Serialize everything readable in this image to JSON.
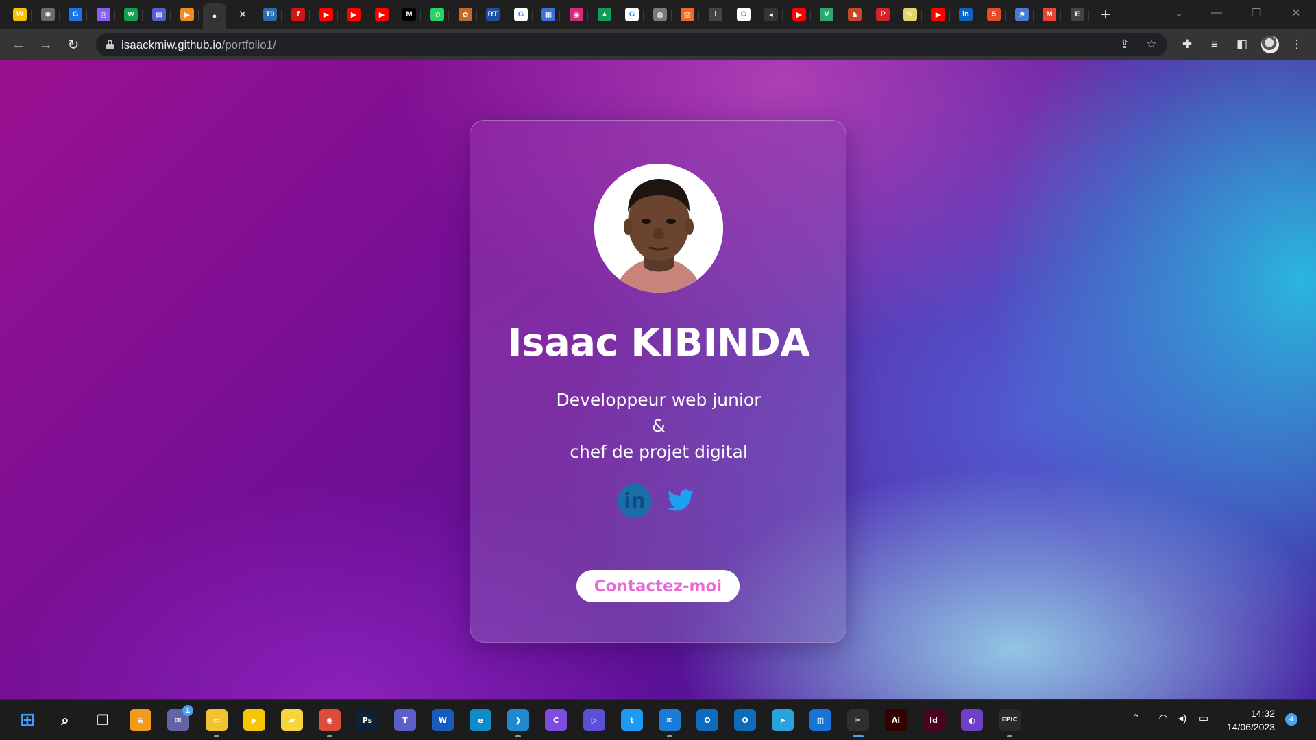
{
  "browser": {
    "address": {
      "domain": "isaackmiw.github.io",
      "path": "/portfolio1/"
    },
    "tabs": [
      {
        "icon": "wordpress-tab-icon",
        "glyph": "W",
        "color": "#f4c400"
      },
      {
        "icon": "chatgpt-tab-icon",
        "glyph": "✺",
        "color": "#6b6b6b"
      },
      {
        "icon": "google-tab-icon",
        "glyph": "G",
        "color": "#1a73e8"
      },
      {
        "icon": "spiral-tab-icon",
        "glyph": "◎",
        "color": "#8b5cf6"
      },
      {
        "icon": "webflow-tab-icon",
        "glyph": "w",
        "color": "#12a150"
      },
      {
        "icon": "stack-tab-icon",
        "glyph": "▤",
        "color": "#5b5bd6"
      },
      {
        "icon": "play-tab-icon",
        "glyph": "▶",
        "color": "#f28c1e"
      },
      {
        "icon": "github-tab-icon",
        "glyph": "●",
        "color": "#333333"
      },
      {
        "icon": "close-tab-icon",
        "glyph": "✕",
        "color": "#353535"
      },
      {
        "icon": "t9-tab-icon",
        "glyph": "T9",
        "color": "#2b6cb0"
      },
      {
        "icon": "flash-tab-icon",
        "glyph": "f",
        "color": "#d31414"
      },
      {
        "icon": "youtube-tab-icon",
        "glyph": "▶",
        "color": "#ff0000"
      },
      {
        "icon": "youtube-tab-icon",
        "glyph": "▶",
        "color": "#ff0000"
      },
      {
        "icon": "youtube-tab-icon",
        "glyph": "▶",
        "color": "#ff0000"
      },
      {
        "icon": "medium-tab-icon",
        "glyph": "M",
        "color": "#000000"
      },
      {
        "icon": "whatsapp-tab-icon",
        "glyph": "✆",
        "color": "#25d366"
      },
      {
        "icon": "puzzle-tab-icon",
        "glyph": "✿",
        "color": "#c46a2a"
      },
      {
        "icon": "retro-tab-icon",
        "glyph": "RT",
        "color": "#1f4fa0"
      },
      {
        "icon": "google-tab-icon",
        "glyph": "G",
        "color": "#ffffff"
      },
      {
        "icon": "calendar-tab-icon",
        "glyph": "▦",
        "color": "#3d6fd6"
      },
      {
        "icon": "instagram-tab-icon",
        "glyph": "◉",
        "color": "#d62976"
      },
      {
        "icon": "drive-tab-icon",
        "glyph": "▲",
        "color": "#0f9d58"
      },
      {
        "icon": "google-tab-icon",
        "glyph": "G",
        "color": "#ffffff"
      },
      {
        "icon": "globe-tab-icon",
        "glyph": "◍",
        "color": "#7a7a7a"
      },
      {
        "icon": "notes-tab-icon",
        "glyph": "▨",
        "color": "#f26522"
      },
      {
        "icon": "info-tab-icon",
        "glyph": "i",
        "color": "#444444"
      },
      {
        "icon": "google-tab-icon",
        "glyph": "G",
        "color": "#ffffff"
      },
      {
        "icon": "speaker-tab-icon",
        "glyph": "◂",
        "color": "#353535"
      },
      {
        "icon": "youtube-tab-icon",
        "glyph": "▶",
        "color": "#ff0000"
      },
      {
        "icon": "vue-tab-icon",
        "glyph": "V",
        "color": "#2ea86b"
      },
      {
        "icon": "chess-tab-icon",
        "glyph": "♞",
        "color": "#c8472b"
      },
      {
        "icon": "p-tab-icon",
        "glyph": "P",
        "color": "#d3232a"
      },
      {
        "icon": "sticky-tab-icon",
        "glyph": "✎",
        "color": "#e6d36a"
      },
      {
        "icon": "youtube-tab-icon",
        "glyph": "▶",
        "color": "#ff0000"
      },
      {
        "icon": "linkedin-tab-icon",
        "glyph": "in",
        "color": "#0a66c2"
      },
      {
        "icon": "html-tab-icon",
        "glyph": "5",
        "color": "#e44d26"
      },
      {
        "icon": "flag-tab-icon",
        "glyph": "⚑",
        "color": "#4a7bd8"
      },
      {
        "icon": "gmail-tab-icon",
        "glyph": "M",
        "color": "#ea4335"
      },
      {
        "icon": "epic-tab-icon",
        "glyph": "E",
        "color": "#444444"
      }
    ]
  },
  "profile": {
    "name": "Isaac KIBINDA",
    "role_line1": "Developpeur web junior",
    "role_amp": "&",
    "role_line2": "chef de projet digital",
    "linkedin_label": "in",
    "contact_label": "Contactez-moi"
  },
  "taskbar": {
    "apps": [
      {
        "icon": "windows-start-icon",
        "glyph": "⊞",
        "color": "#3aa0ff"
      },
      {
        "icon": "search-icon",
        "glyph": "⌕",
        "color": "transparent"
      },
      {
        "icon": "task-view-icon",
        "glyph": "❐",
        "color": "transparent"
      },
      {
        "icon": "stack-app-icon",
        "glyph": "≋",
        "color": "#f29a1c"
      },
      {
        "icon": "teams-chat-icon",
        "glyph": "✉",
        "color": "#6264a7"
      },
      {
        "icon": "file-explorer-icon",
        "glyph": "▭",
        "color": "#f1c232"
      },
      {
        "icon": "player-icon",
        "glyph": "▶",
        "color": "#f3c800"
      },
      {
        "icon": "sticky-notes-icon",
        "glyph": "▰",
        "color": "#f7d53c"
      },
      {
        "icon": "chrome-icon",
        "glyph": "◉",
        "color": "#dd4b39"
      },
      {
        "icon": "photoshop-icon",
        "glyph": "Ps",
        "color": "#0d2335"
      },
      {
        "icon": "teams-icon",
        "glyph": "T",
        "color": "#5b5fc7"
      },
      {
        "icon": "word-icon",
        "glyph": "W",
        "color": "#185abd"
      },
      {
        "icon": "edge-icon",
        "glyph": "e",
        "color": "#0f8bc6"
      },
      {
        "icon": "vscode-icon",
        "glyph": "❯",
        "color": "#1f8ad2"
      },
      {
        "icon": "canva-icon",
        "glyph": "C",
        "color": "#7d4ce0"
      },
      {
        "icon": "power-automate-icon",
        "glyph": "▷",
        "color": "#5a4fd6"
      },
      {
        "icon": "twitter-app-icon",
        "glyph": "t",
        "color": "#1d9bf0"
      },
      {
        "icon": "mail-icon",
        "glyph": "✉",
        "color": "#1c7bd8"
      },
      {
        "icon": "outlook-icon",
        "glyph": "O",
        "color": "#0f6cbd"
      },
      {
        "icon": "outlook-beta-icon",
        "glyph": "O",
        "color": "#0f6cbd"
      },
      {
        "icon": "telegram-icon",
        "glyph": "➤",
        "color": "#2aa3dd"
      },
      {
        "icon": "trello-icon",
        "glyph": "▥",
        "color": "#1773d8"
      },
      {
        "icon": "snipping-tool-icon",
        "glyph": "✂",
        "color": "#2f2f2f"
      },
      {
        "icon": "illustrator-icon",
        "glyph": "Ai",
        "color": "#330000"
      },
      {
        "icon": "indesign-icon",
        "glyph": "Id",
        "color": "#49021f"
      },
      {
        "icon": "github-desktop-icon",
        "glyph": "◐",
        "color": "#6e40c9"
      },
      {
        "icon": "epic-games-icon",
        "glyph": "EPIC",
        "color": "#2a2a2a"
      }
    ],
    "time": "14:32",
    "date": "14/06/2023",
    "notifications": "4",
    "chat_badge": "1"
  }
}
